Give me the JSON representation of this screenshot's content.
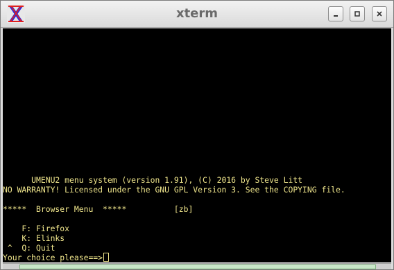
{
  "window": {
    "title": "xterm"
  },
  "icons": {
    "app": "xterm-x-icon",
    "minimize": "minimize-icon",
    "maximize": "maximize-icon",
    "close": "close-icon"
  },
  "colors": {
    "terminal_bg": "#000000",
    "terminal_fg": "#f0e68c",
    "title_text": "#6a6a6a",
    "scroll_thumb": "#c8e6c8"
  },
  "terminal": {
    "lines": [
      "      UMENU2 menu system (version 1.91), (C) 2016 by Steve Litt",
      "NO WARRANTY! Licensed under the GNU GPL Version 3. See the COPYING file.",
      "",
      "*****  Browser Menu  *****          [zb]",
      "",
      "    F: Firefox",
      "    K: Elinks",
      " ^  Q: Quit"
    ],
    "prompt": "Your choice please==>"
  }
}
